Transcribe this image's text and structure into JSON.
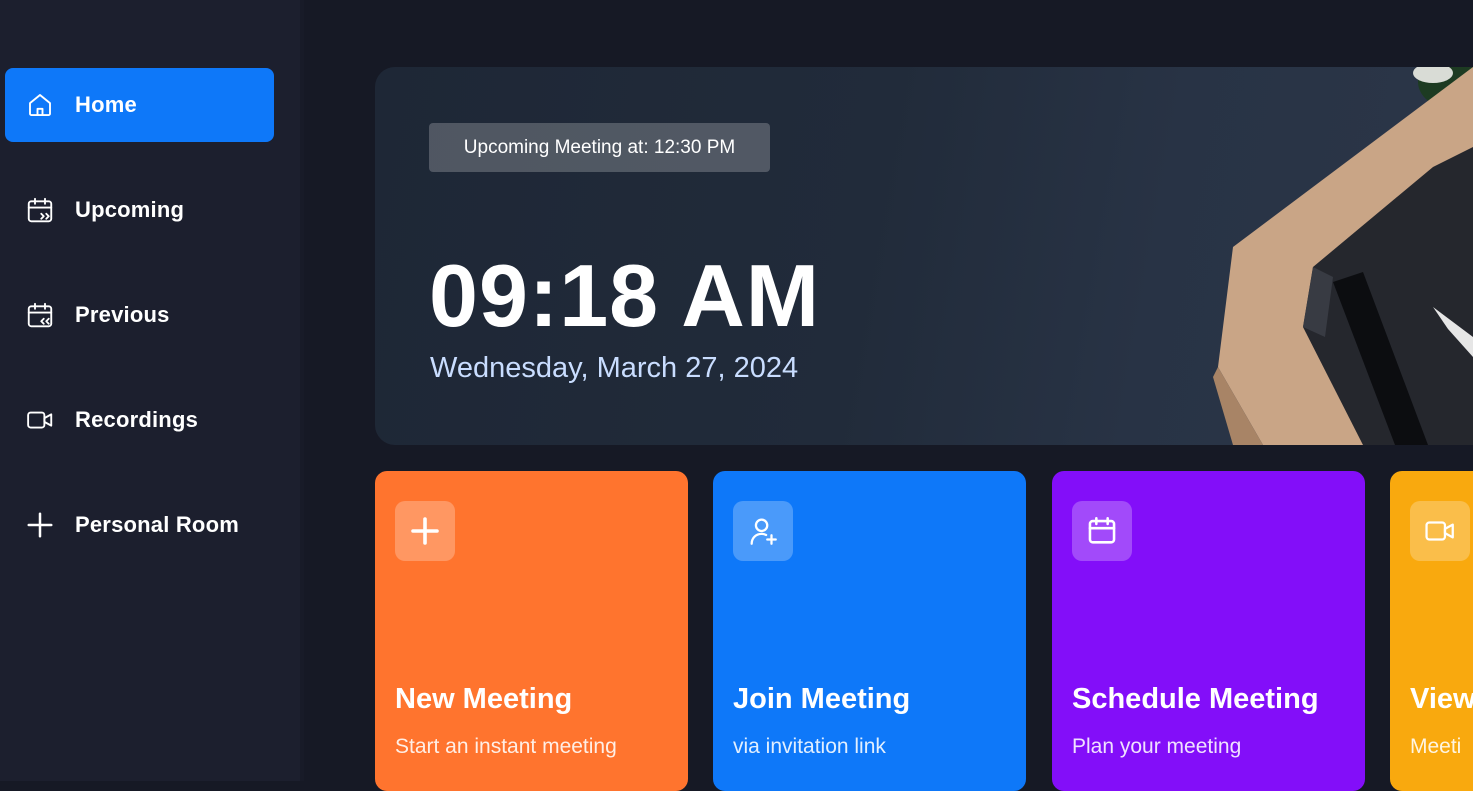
{
  "sidebar": {
    "items": [
      {
        "label": "Home",
        "icon": "home-icon",
        "active": true
      },
      {
        "label": "Upcoming",
        "icon": "calendar-upcoming-icon",
        "active": false
      },
      {
        "label": "Previous",
        "icon": "calendar-previous-icon",
        "active": false
      },
      {
        "label": "Recordings",
        "icon": "video-icon",
        "active": false
      },
      {
        "label": "Personal Room",
        "icon": "plus-icon",
        "active": false
      }
    ]
  },
  "hero": {
    "badge": "Upcoming Meeting at: 12:30 PM",
    "time": "09:18 AM",
    "date": "Wednesday, March 27, 2024"
  },
  "cards": [
    {
      "title": "New Meeting",
      "subtitle": "Start an instant meeting",
      "icon": "plus-icon",
      "color": "#ff742e"
    },
    {
      "title": "Join Meeting",
      "subtitle": "via invitation link",
      "icon": "add-user-icon",
      "color": "#0e78f9"
    },
    {
      "title": "Schedule Meeting",
      "subtitle": "Plan your meeting",
      "icon": "calendar-icon",
      "color": "#830ef9"
    },
    {
      "title": "View",
      "subtitle": "Meeti",
      "icon": "video-icon",
      "color": "#f9a90e"
    }
  ],
  "colors": {
    "accent": "#0e78f9",
    "sidebar_bg": "#1c1f2e",
    "page_bg": "#161925"
  }
}
